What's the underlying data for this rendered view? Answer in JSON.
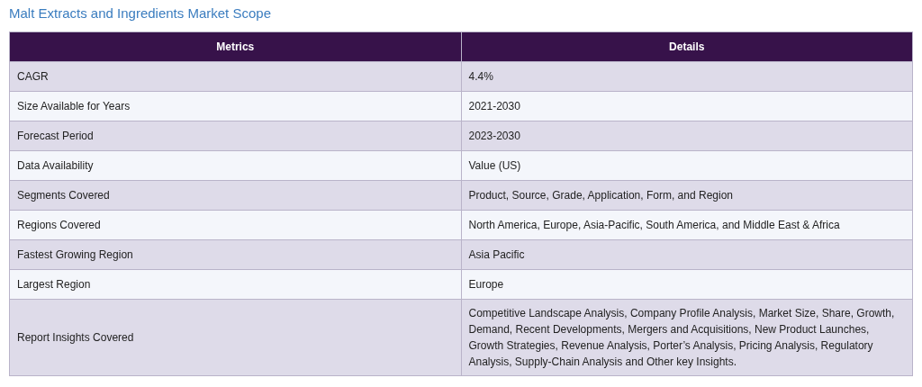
{
  "title": "Malt Extracts and Ingredients Market Scope",
  "table": {
    "columns": [
      "Metrics",
      "Details"
    ],
    "rows": [
      [
        "CAGR",
        "4.4%"
      ],
      [
        "Size Available for Years",
        "2021-2030"
      ],
      [
        "Forecast Period",
        "2023-2030"
      ],
      [
        "Data Availability",
        "Value (US)"
      ],
      [
        "Segments Covered",
        "Product, Source, Grade, Application, Form, and Region"
      ],
      [
        "Regions Covered",
        "North America, Europe, Asia-Pacific, South America, and Middle East & Africa"
      ],
      [
        "Fastest Growing Region",
        "Asia Pacific"
      ],
      [
        "Largest Region",
        "Europe"
      ],
      [
        "Report Insights Covered",
        "Competitive Landscape Analysis, Company Profile Analysis, Market Size, Share, Growth, Demand, Recent Developments, Mergers and Acquisitions, New Product Launches, Growth Strategies, Revenue Analysis, Porter’s Analysis, Pricing Analysis, Regulatory Analysis, Supply-Chain Analysis and Other key Insights."
      ]
    ]
  }
}
